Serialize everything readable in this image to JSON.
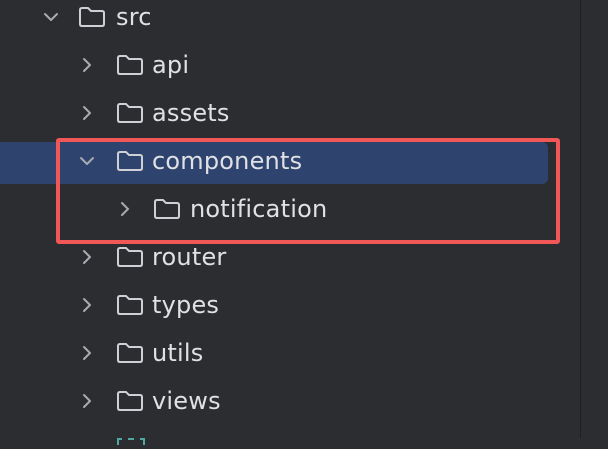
{
  "tree": {
    "items": [
      {
        "label": "src",
        "expanded": true,
        "selected": false
      },
      {
        "label": "api",
        "expanded": false,
        "selected": false
      },
      {
        "label": "assets",
        "expanded": false,
        "selected": false
      },
      {
        "label": "components",
        "expanded": true,
        "selected": true
      },
      {
        "label": "notification",
        "expanded": false,
        "selected": false
      },
      {
        "label": "router",
        "expanded": false,
        "selected": false
      },
      {
        "label": "types",
        "expanded": false,
        "selected": false
      },
      {
        "label": "utils",
        "expanded": false,
        "selected": false
      },
      {
        "label": "views",
        "expanded": false,
        "selected": false
      }
    ]
  },
  "colors": {
    "background": "#2b2d30",
    "selection": "#2e436e",
    "highlight_border": "#f25757",
    "text": "#dfe1e5",
    "icon_stroke": "#ced0d6",
    "chevron": "#a8abb0",
    "partial_icon": "#4fa9a0"
  },
  "icons": {
    "expanded": "chevron-down-icon",
    "collapsed": "chevron-right-icon",
    "folder": "folder-icon"
  }
}
